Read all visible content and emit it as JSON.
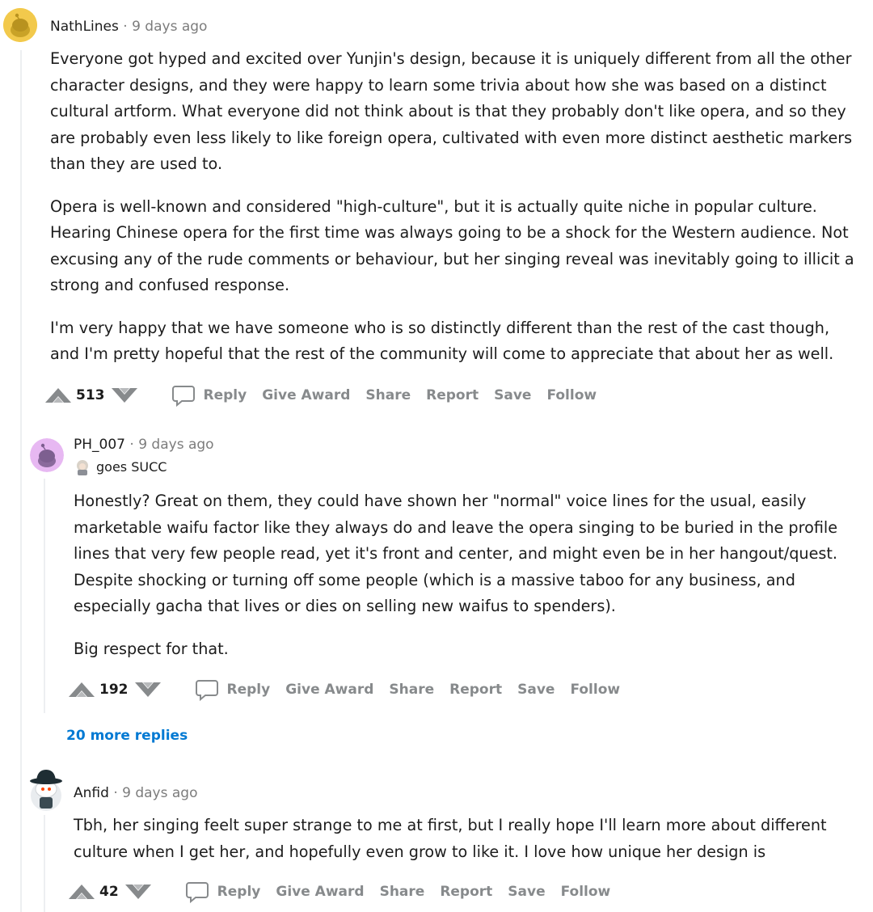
{
  "comments": [
    {
      "username": "NathLines",
      "dot": "·",
      "time": "9 days ago",
      "paragraphs": [
        "Everyone got hyped and excited over Yunjin's design, because it is uniquely different from all the other character designs, and they were happy to learn some trivia about how she was based on a distinct cultural artform. What everyone did not think about is that they probably don't like opera, and so they are probably even less likely to like foreign opera, cultivated with even more distinct aesthetic markers than they are used to.",
        "Opera is well-known and considered \"high-culture\", but it is actually quite niche in popular culture. Hearing Chinese opera for the first time was always going to be a shock for the Western audience. Not excusing any of the rude comments or behaviour, but her singing reveal was inevitably going to illicit a strong and confused response.",
        "I'm very happy that we have someone who is so distinctly different than the rest of the cast though, and I'm pretty hopeful that the rest of the community will come to appreciate that about her as well."
      ],
      "score": "513"
    },
    {
      "username": "PH_007",
      "dot": "·",
      "time": "9 days ago",
      "flair": "goes SUCC",
      "paragraphs": [
        "Honestly? Great on them, they could have shown her \"normal\" voice lines for the usual, easily marketable waifu factor like they always do and leave the opera singing to be buried in the profile lines that very few people read, yet it's front and center, and might even be in her hangout/quest. Despite shocking or turning off some people (which is a massive taboo for any business, and especially gacha that lives or dies on selling new waifus to spenders).",
        "Big respect for that."
      ],
      "score": "192"
    },
    {
      "username": "Anfid",
      "dot": "·",
      "time": "9 days ago",
      "paragraphs": [
        "Tbh, her singing feelt super strange to me at first, but I really hope I'll learn more about different culture when I get her, and hopefully even grow to like it. I love how unique her design is"
      ],
      "score": "42"
    }
  ],
  "actions": {
    "reply": "Reply",
    "give_award": "Give Award",
    "share": "Share",
    "report": "Report",
    "save": "Save",
    "follow": "Follow"
  },
  "more_replies": "20 more replies",
  "icons": {
    "upvote": "upvote-icon",
    "downvote": "downvote-icon",
    "reply": "comment-bubble-icon"
  },
  "colors": {
    "text": "#1c1c1c",
    "meta": "#7c7c7c",
    "action": "#878a8c",
    "link": "#0079d3",
    "vote": "#878a8c"
  }
}
